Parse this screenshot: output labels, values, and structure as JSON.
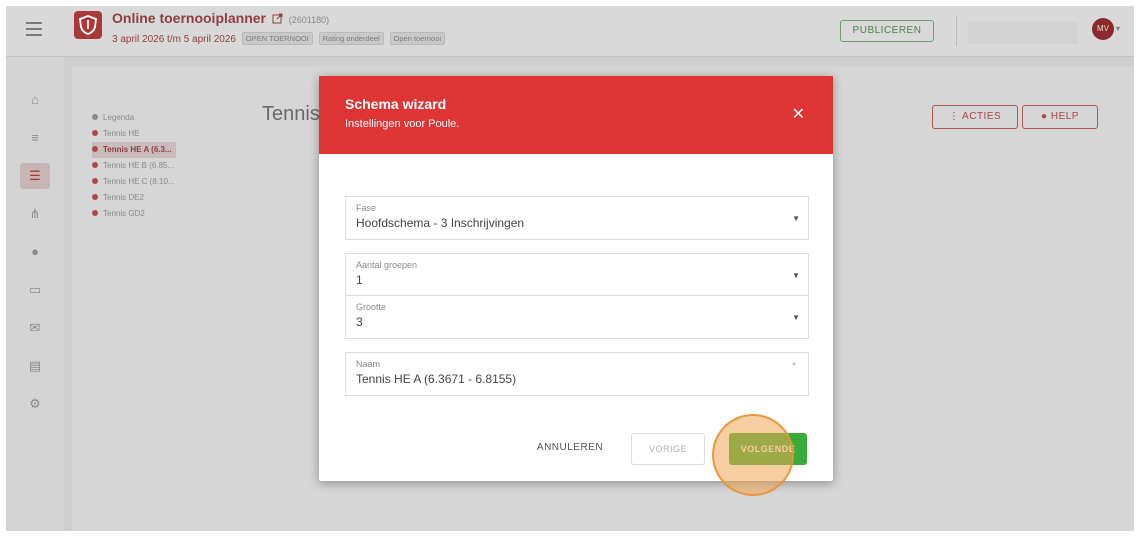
{
  "header": {
    "app_title": "Online toernooiplanner",
    "app_id": "(2601180)",
    "dates": "3 april 2026 t/m 5 april 2026",
    "badges": [
      "OPEN TOERNOOI",
      "Rating onderdeel",
      "Open toernooi"
    ],
    "publish_label": "PUBLICEREN",
    "avatar_initials": "MV"
  },
  "legend": {
    "title": "Legenda",
    "items": [
      "Tennis HE",
      "Tennis HE A (6.3...",
      "Tennis HE B (6.85...",
      "Tennis HE C (8.10...",
      "Tennis DE2",
      "Tennis GD2"
    ]
  },
  "page": {
    "title": "Tennis",
    "acties_label": "ACTIES",
    "help_label": "HELP"
  },
  "modal": {
    "title": "Schema wizard",
    "subtitle": "Instellingen voor Poule.",
    "fields": [
      {
        "label": "Fase",
        "value": "Hoofdschema - 3 Inschrijvingen"
      },
      {
        "label": "Aantal groepen",
        "value": "1"
      },
      {
        "label": "Grootte",
        "value": "3"
      },
      {
        "label": "Naam",
        "value": "Tennis HE A (6.3671 - 6.8155)"
      }
    ],
    "cancel_label": "ANNULEREN",
    "prev_label": "VORIGE",
    "next_label": "VOLGENDE"
  },
  "colors": {
    "accent": "#de3434",
    "primary_green": "#3aaa3a",
    "highlight": "#eea550"
  }
}
